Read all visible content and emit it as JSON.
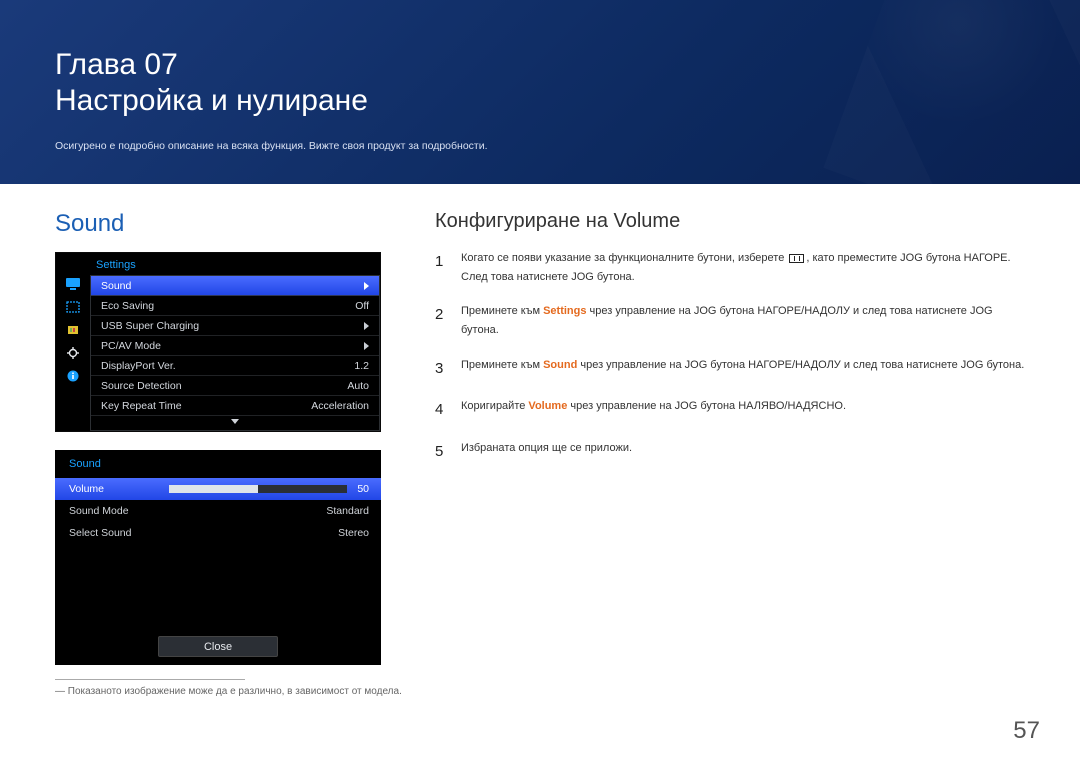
{
  "header": {
    "chapter_prefix": "Глава",
    "chapter_number": "07",
    "chapter_title": "Настройка и нулиране",
    "chapter_desc": "Осигурено е подробно описание на всяка функция. Вижте своя продукт за подробности."
  },
  "left": {
    "sound_heading": "Sound",
    "osd": {
      "header": "Settings",
      "items": [
        {
          "label": "Sound",
          "value_type": "arrow",
          "selected": true
        },
        {
          "label": "Eco Saving",
          "value": "Off"
        },
        {
          "label": "USB Super Charging",
          "value_type": "arrow"
        },
        {
          "label": "PC/AV Mode",
          "value_type": "arrow"
        },
        {
          "label": "DisplayPort Ver.",
          "value": "1.2"
        },
        {
          "label": "Source Detection",
          "value": "Auto"
        },
        {
          "label": "Key Repeat Time",
          "value": "Acceleration"
        }
      ]
    },
    "sound_panel": {
      "title": "Sound",
      "rows": [
        {
          "label": "Volume",
          "slider": 50,
          "value": "50",
          "selected": true
        },
        {
          "label": "Sound Mode",
          "value": "Standard"
        },
        {
          "label": "Select Sound",
          "value": "Stereo"
        }
      ],
      "close": "Close"
    },
    "footnote": "― Показаното изображение може да е различно, в зависимост от модела."
  },
  "right": {
    "subheading": "Конфигуриране на Volume",
    "steps": [
      {
        "num": "1",
        "parts": [
          {
            "t": "Когато се появи указание за функционалните бутони, изберете "
          },
          {
            "icon": true
          },
          {
            "t": ", като преместите JOG бутона НАГОРЕ. След това натиснете JOG бутона."
          }
        ]
      },
      {
        "num": "2",
        "parts": [
          {
            "t": "Преминете към "
          },
          {
            "kw": "Settings"
          },
          {
            "t": " чрез управление на JOG бутона НАГОРЕ/НАДОЛУ и след това натиснете JOG бутона."
          }
        ]
      },
      {
        "num": "3",
        "parts": [
          {
            "t": "Преминете към "
          },
          {
            "kw": "Sound"
          },
          {
            "t": " чрез управление на JOG бутона НАГОРЕ/НАДОЛУ и след това натиснете JOG бутона."
          }
        ]
      },
      {
        "num": "4",
        "parts": [
          {
            "t": "Коригирайте "
          },
          {
            "kw": "Volume"
          },
          {
            "t": " чрез управление на JOG бутона НАЛЯВО/НАДЯСНО."
          }
        ]
      },
      {
        "num": "5",
        "parts": [
          {
            "t": "Избраната опция ще се приложи."
          }
        ]
      }
    ]
  },
  "page_number": "57"
}
